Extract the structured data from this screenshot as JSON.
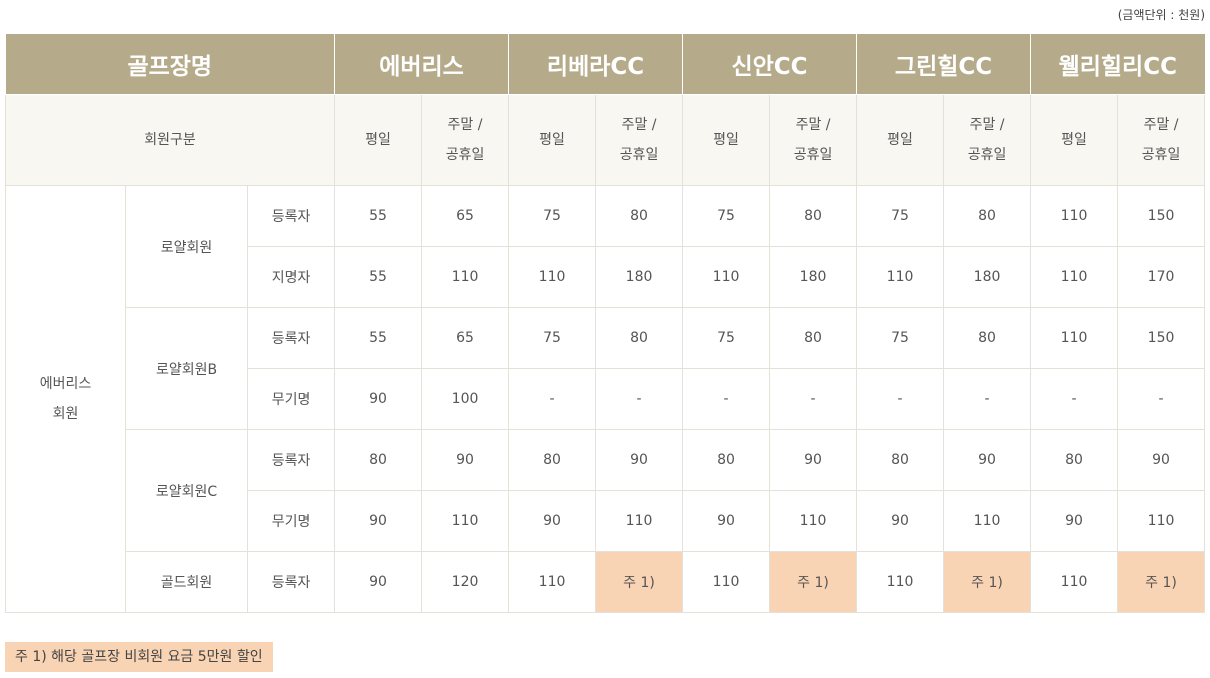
{
  "unit_label": "(금액단위 : 천원)",
  "header": {
    "course_label": "골프장명",
    "courses": [
      "에버리스",
      "리베라CC",
      "신안CC",
      "그린힐CC",
      "웰리힐리CC"
    ],
    "member_type_label": "회원구분",
    "weekday": "평일",
    "weekend_line1": "주말 /",
    "weekend_line2": "공휴일"
  },
  "group": {
    "line1": "에버리스",
    "line2": "회원"
  },
  "rows": [
    {
      "membership": "로얄회원",
      "type": "등록자",
      "values": [
        "55",
        "65",
        "75",
        "80",
        "75",
        "80",
        "75",
        "80",
        "110",
        "150"
      ]
    },
    {
      "membership": "",
      "type": "지명자",
      "values": [
        "55",
        "110",
        "110",
        "180",
        "110",
        "180",
        "110",
        "180",
        "110",
        "170"
      ]
    },
    {
      "membership": "로얄회원B",
      "type": "등록자",
      "values": [
        "55",
        "65",
        "75",
        "80",
        "75",
        "80",
        "75",
        "80",
        "110",
        "150"
      ]
    },
    {
      "membership": "",
      "type": "무기명",
      "values": [
        "90",
        "100",
        "-",
        "-",
        "-",
        "-",
        "-",
        "-",
        "-",
        "-"
      ]
    },
    {
      "membership": "로얄회원C",
      "type": "등록자",
      "values": [
        "80",
        "90",
        "80",
        "90",
        "80",
        "90",
        "80",
        "90",
        "80",
        "90"
      ]
    },
    {
      "membership": "",
      "type": "무기명",
      "values": [
        "90",
        "110",
        "90",
        "110",
        "90",
        "110",
        "90",
        "110",
        "90",
        "110"
      ]
    },
    {
      "membership": "골드회원",
      "type": "등록자",
      "values": [
        "90",
        "120",
        "110",
        "주 1)",
        "110",
        "주 1)",
        "110",
        "주 1)",
        "110",
        "주 1)"
      ]
    }
  ],
  "note": "주 1)  해당 골프장 비회원 요금 5만원 할인",
  "colors": {
    "header_bg": "#b5ab8b",
    "subheader_bg": "#f8f7f2",
    "highlight_bg": "#f9d4b4"
  }
}
